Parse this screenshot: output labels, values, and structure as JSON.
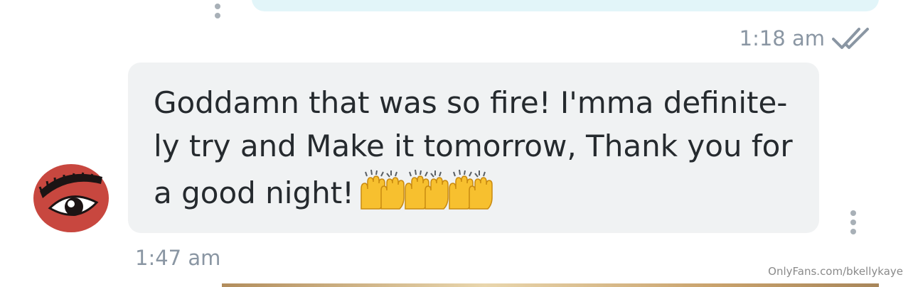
{
  "previous_message": {
    "time": "1:18 am",
    "status_icon": "double-check-icon"
  },
  "message": {
    "line1": "Goddamn that was so fire! I'mma definite-",
    "line2": "ly try and Make it tomorrow, Thank you for",
    "line3": "a good night!",
    "emoji": "🙌🙌🙌",
    "time": "1:47 am"
  },
  "avatar": {
    "icon": "eye-avatar-icon"
  },
  "watermark": "OnlyFans.com/bkellykaye",
  "colors": {
    "sent_bubble": "#e2f5f9",
    "received_bubble": "#f0f2f3",
    "timestamp": "#8a96a3",
    "text": "#252a2e",
    "avatar_red": "#c8473f"
  }
}
